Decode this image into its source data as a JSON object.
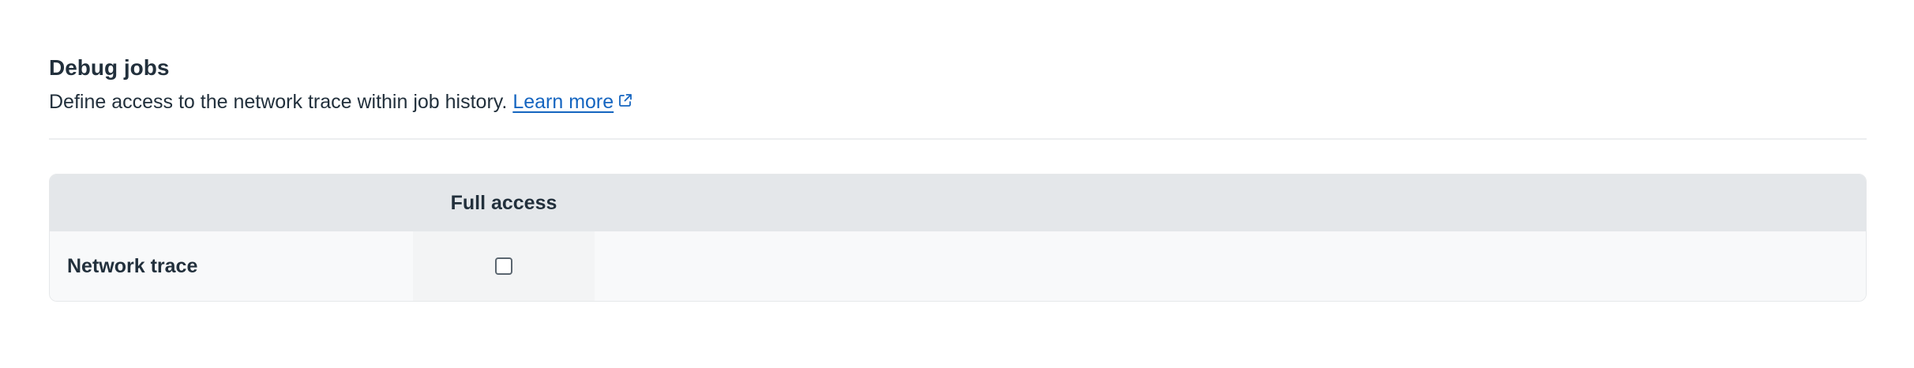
{
  "section": {
    "title": "Debug jobs",
    "description": "Define access to the network trace within job history.",
    "learn_more_label": "Learn more",
    "link_icon": "external-link-icon",
    "link_color": "#1565c0"
  },
  "table": {
    "columns": [
      "",
      "Full access"
    ],
    "rows": [
      {
        "label": "Network trace",
        "full_access_checked": false
      }
    ]
  }
}
